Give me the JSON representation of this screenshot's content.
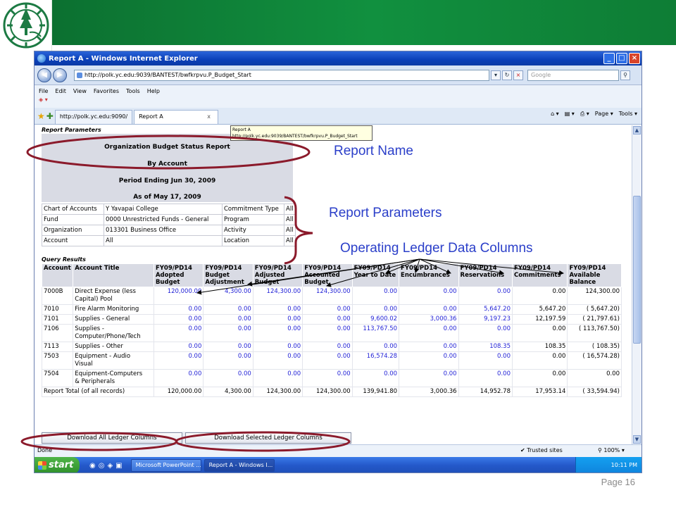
{
  "slide": {
    "page_label": "Page 16",
    "colors": {
      "banner": "#11903f",
      "annotation_text": "#2b3fc9",
      "annotation_ring": "#8b1a2b"
    }
  },
  "browser": {
    "title": "Report A - Windows Internet Explorer",
    "url": "http://polk.yc.edu:9039/BANTEST/bwfkrpvu.P_Budget_Start",
    "search_placeholder": "Google",
    "menu": [
      "File",
      "Edit",
      "View",
      "Favorites",
      "Tools",
      "Help"
    ],
    "tabs": [
      {
        "label": "http://polk.yc.edu:9090/"
      },
      {
        "label": "Report A",
        "close": "x"
      }
    ],
    "toolbar_right": [
      "Page ▾",
      "Tools ▾"
    ],
    "tooltip": {
      "line1": "Report A",
      "line2": "http://polk.yc.edu:9039/BANTEST/bwfkrpvu.P_Budget_Start"
    },
    "status": {
      "text": "Done",
      "zone": "Trusted sites",
      "zoom": "100%"
    }
  },
  "taskbar": {
    "start_label": "start",
    "items": [
      "Microsoft PowerPoint ...",
      "Report A - Windows I..."
    ],
    "clock": "10:11 PM"
  },
  "report": {
    "params_title": "Report Parameters",
    "header_lines": [
      "Organization Budget Status Report",
      "By Account",
      "Period Ending Jun 30, 2009",
      "As of May 17, 2009"
    ],
    "params": [
      [
        "Chart of Accounts",
        "Y Yavapai College",
        "Commitment Type",
        "All"
      ],
      [
        "Fund",
        "0000 Unrestricted Funds - General",
        "Program",
        "All"
      ],
      [
        "Organization",
        "013301 Business Office",
        "Activity",
        "All"
      ],
      [
        "Account",
        "All",
        "Location",
        "All"
      ]
    ],
    "query_title": "Query Results",
    "columns": [
      [
        "Account"
      ],
      [
        "Account Title"
      ],
      [
        "FY09/PD14",
        "Adopted",
        "Budget"
      ],
      [
        "FY09/PD14",
        "Budget",
        "Adjustment"
      ],
      [
        "FY09/PD14",
        "Adjusted",
        "Budget"
      ],
      [
        "FY09/PD14",
        "Accounted",
        "Budget"
      ],
      [
        "FY09/PD14",
        "Year to Date"
      ],
      [
        "FY09/PD14",
        "Encumbrances"
      ],
      [
        "FY09/PD14",
        "Reservations"
      ],
      [
        "FY09/PD14",
        "Commitments"
      ],
      [
        "FY09/PD14",
        "Available",
        "Balance"
      ]
    ],
    "rows": [
      {
        "account": "7000B",
        "title": [
          "Direct Expense (less",
          "Capital) Pool"
        ],
        "values": [
          "120,000.00",
          "4,300.00",
          "124,300.00",
          "124,300.00",
          "0.00",
          "0.00",
          "0.00",
          "0.00",
          "124,300.00"
        ]
      },
      {
        "account": "7010",
        "title": [
          "Fire Alarm Monitoring"
        ],
        "values": [
          "0.00",
          "0.00",
          "0.00",
          "0.00",
          "0.00",
          "0.00",
          "5,647.20",
          "5,647.20",
          "( 5,647.20)"
        ]
      },
      {
        "account": "7101",
        "title": [
          "Supplies - General"
        ],
        "values": [
          "0.00",
          "0.00",
          "0.00",
          "0.00",
          "9,600.02",
          "3,000.36",
          "9,197.23",
          "12,197.59",
          "( 21,797.61)"
        ]
      },
      {
        "account": "7106",
        "title": [
          "Supplies -",
          "Computer/Phone/Tech"
        ],
        "values": [
          "0.00",
          "0.00",
          "0.00",
          "0.00",
          "113,767.50",
          "0.00",
          "0.00",
          "0.00",
          "( 113,767.50)"
        ]
      },
      {
        "account": "7113",
        "title": [
          "Supplies - Other"
        ],
        "values": [
          "0.00",
          "0.00",
          "0.00",
          "0.00",
          "0.00",
          "0.00",
          "108.35",
          "108.35",
          "( 108.35)"
        ]
      },
      {
        "account": "7503",
        "title": [
          "Equipment - Audio",
          "Visual"
        ],
        "values": [
          "0.00",
          "0.00",
          "0.00",
          "0.00",
          "16,574.28",
          "0.00",
          "0.00",
          "0.00",
          "( 16,574.28)"
        ]
      },
      {
        "account": "7504",
        "title": [
          "Equipment-Computers",
          "& Peripherals"
        ],
        "values": [
          "0.00",
          "0.00",
          "0.00",
          "0.00",
          "0.00",
          "0.00",
          "0.00",
          "0.00",
          "0.00"
        ]
      }
    ],
    "total": {
      "label": "Report Total (of all records)",
      "values": [
        "120,000.00",
        "4,300.00",
        "124,300.00",
        "124,300.00",
        "139,941.80",
        "3,000.36",
        "14,952.78",
        "17,953.14",
        "( 33,594.94)"
      ]
    },
    "buttons": {
      "download_all": "Download All Ledger Columns",
      "download_selected": "Download Selected Ledger Columns"
    }
  },
  "annotations": {
    "report_name": "Report Name",
    "report_parameters": "Report Parameters",
    "ledger_columns": "Operating Ledger Data Columns"
  }
}
